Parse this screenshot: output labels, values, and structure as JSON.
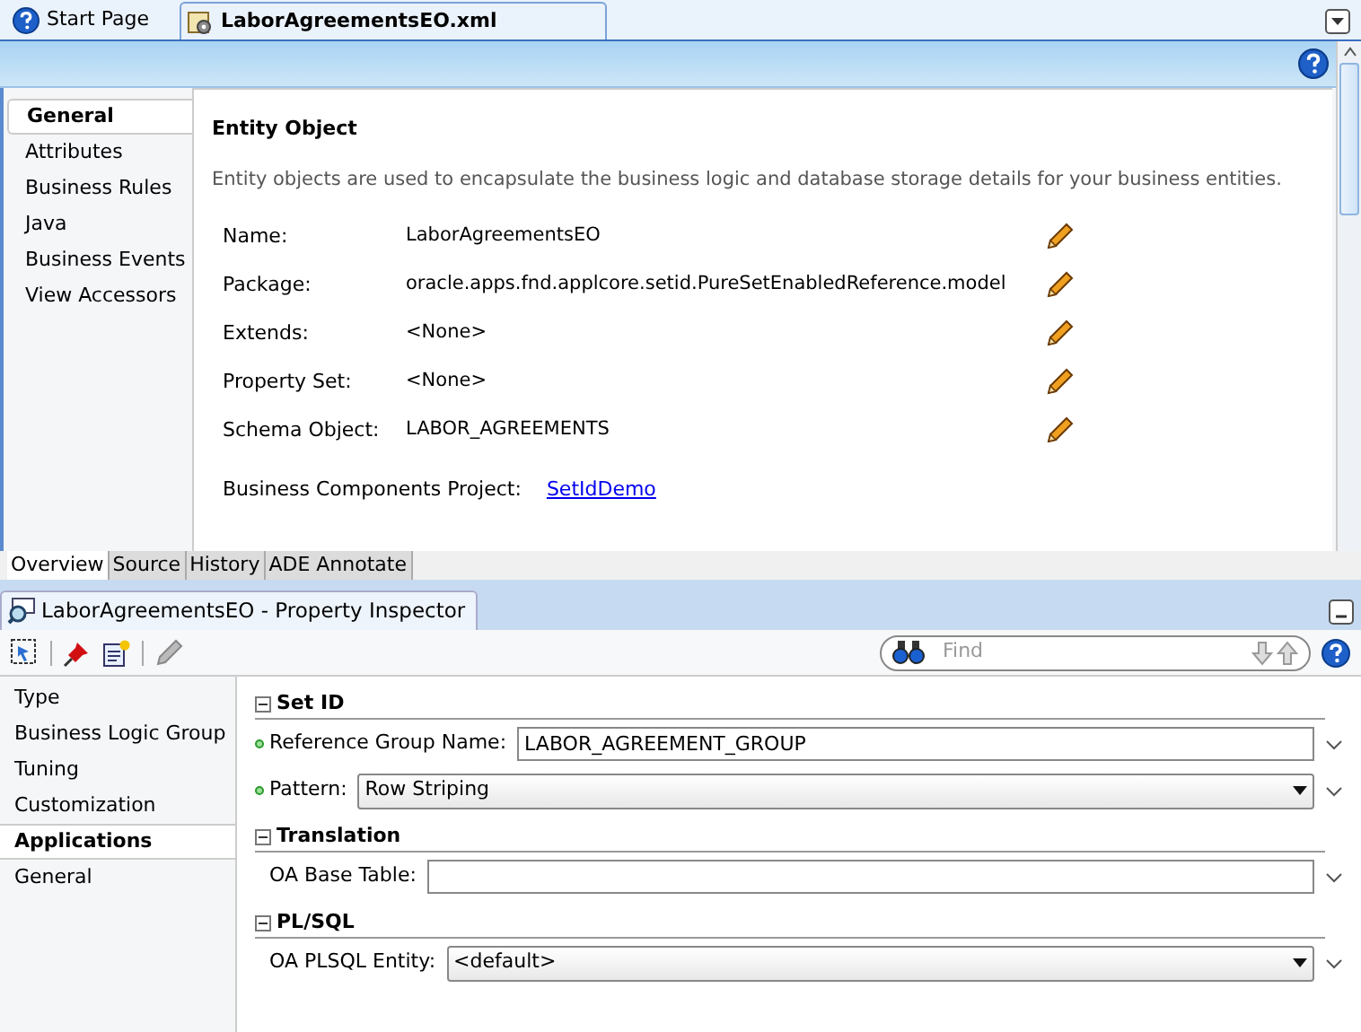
{
  "editor_tabs": [
    {
      "label": "Start Page",
      "kind": "help",
      "selected": false
    },
    {
      "label": "LaborAgreementsEO.xml",
      "kind": "file",
      "selected": true
    }
  ],
  "overview": {
    "nav": [
      {
        "label": "General",
        "selected": true
      },
      {
        "label": "Attributes",
        "selected": false
      },
      {
        "label": "Business Rules",
        "selected": false
      },
      {
        "label": "Java",
        "selected": false
      },
      {
        "label": "Business Events",
        "selected": false
      },
      {
        "label": "View Accessors",
        "selected": false
      }
    ],
    "heading": "Entity Object",
    "description": "Entity objects are used to encapsulate the business logic and database storage details for your business entities.",
    "fields": [
      {
        "label": "Name:",
        "value": "LaborAgreementsEO"
      },
      {
        "label": "Package:",
        "value": "oracle.apps.fnd.applcore.setid.PureSetEnabledReference.model"
      },
      {
        "label": "Extends:",
        "value": "<None>"
      },
      {
        "label": "Property Set:",
        "value": "<None>"
      },
      {
        "label": "Schema Object:",
        "value": "LABOR_AGREEMENTS"
      }
    ],
    "project": {
      "label": "Business Components Project:",
      "link": "SetIdDemo"
    }
  },
  "bottom_tabs": [
    {
      "label": "Overview",
      "selected": true
    },
    {
      "label": "Source",
      "selected": false
    },
    {
      "label": "History",
      "selected": false
    },
    {
      "label": "ADE Annotate",
      "selected": false
    }
  ],
  "inspector": {
    "title": "LaborAgreementsEO - Property Inspector",
    "find": {
      "placeholder": "Find"
    },
    "nav": [
      {
        "label": "Type",
        "kind": "item",
        "selected": false
      },
      {
        "label": "Business Logic Group",
        "kind": "item",
        "selected": false
      },
      {
        "label": "Tuning",
        "kind": "item",
        "selected": false
      },
      {
        "label": "Customization",
        "kind": "item",
        "selected": false
      },
      {
        "label": "Applications",
        "kind": "item",
        "selected": true
      },
      {
        "label": "General",
        "kind": "item",
        "selected": false
      }
    ],
    "sections": [
      {
        "title": "Set ID",
        "expanded": true,
        "rows": [
          {
            "label": "Reference Group Name:",
            "kind": "text",
            "required": true,
            "value": "LABOR_AGREEMENT_GROUP"
          },
          {
            "label": "Pattern:",
            "kind": "select",
            "required": true,
            "value": "Row Striping"
          }
        ]
      },
      {
        "title": "Translation",
        "expanded": true,
        "rows": [
          {
            "label": "OA Base Table:",
            "kind": "text",
            "required": false,
            "value": ""
          }
        ]
      },
      {
        "title": "PL/SQL",
        "expanded": true,
        "rows": [
          {
            "label": "OA PLSQL Entity:",
            "kind": "select",
            "required": false,
            "value": "<default>"
          }
        ]
      }
    ]
  }
}
